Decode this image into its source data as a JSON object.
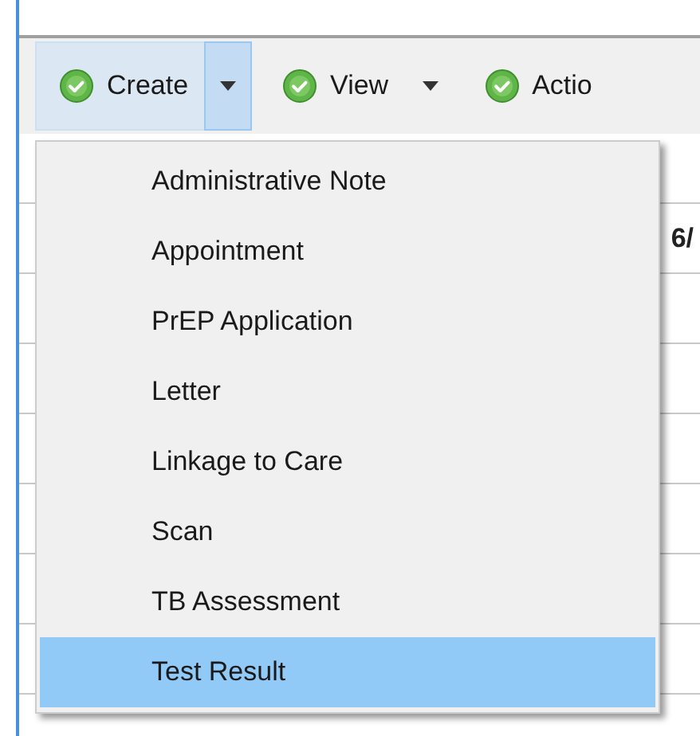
{
  "toolbar": {
    "buttons": [
      {
        "label": "Create",
        "dropdown": true,
        "selected": true
      },
      {
        "label": "View",
        "dropdown": true,
        "selected": false
      },
      {
        "label": "Actio",
        "dropdown": false,
        "selected": false
      }
    ]
  },
  "table": {
    "cell_fragment": "6/"
  },
  "menu": {
    "items": [
      {
        "label": "Administrative Note",
        "selected": false
      },
      {
        "label": "Appointment",
        "selected": false
      },
      {
        "label": "PrEP Application",
        "selected": false
      },
      {
        "label": "Letter",
        "selected": false
      },
      {
        "label": "Linkage to Care",
        "selected": false
      },
      {
        "label": "Scan",
        "selected": false
      },
      {
        "label": "TB Assessment",
        "selected": false
      },
      {
        "label": "Test Result",
        "selected": true
      }
    ]
  }
}
